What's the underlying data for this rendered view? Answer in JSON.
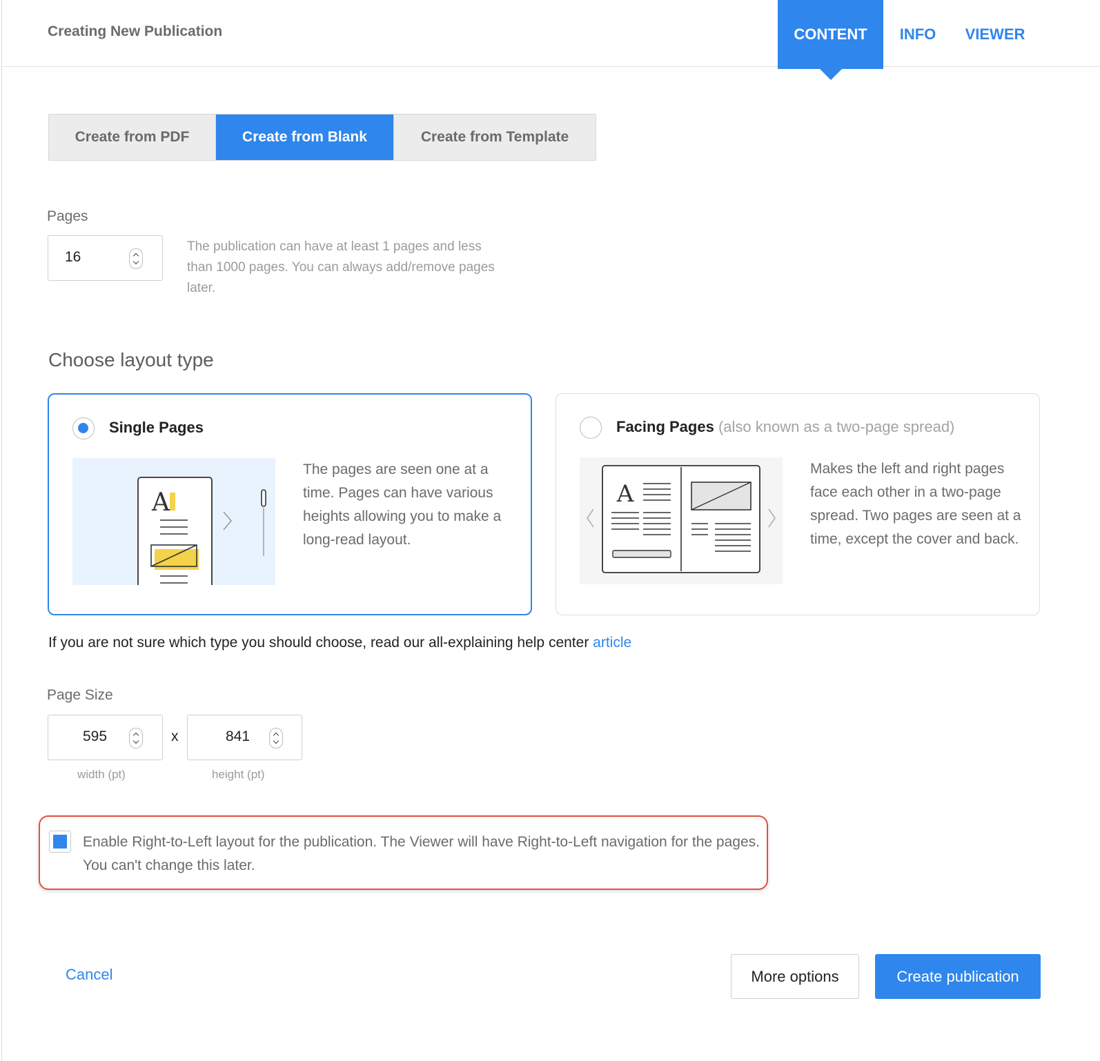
{
  "header": {
    "title": "Creating New Publication",
    "tabs": [
      {
        "label": "CONTENT"
      },
      {
        "label": "INFO"
      },
      {
        "label": "VIEWER"
      }
    ]
  },
  "source_options": {
    "items": [
      {
        "label": "Create from PDF"
      },
      {
        "label": "Create from Blank"
      },
      {
        "label": "Create from Template"
      }
    ],
    "selected": "Create from Blank"
  },
  "pages": {
    "label": "Pages",
    "value": "16",
    "hint": "The publication can have at least 1 pages and less than 1000 pages. You can always add/remove pages later."
  },
  "layout": {
    "title": "Choose layout type",
    "single": {
      "title": "Single Pages",
      "description": "The pages are seen one at a time. Pages can have various heights allowing you to make a long-read layout."
    },
    "facing": {
      "title": "Facing Pages",
      "subtitle": "(also known as a two-page spread)",
      "description": "Makes the left and right pages face each other in a two-page spread. Two pages are seen at a time, except the cover and back."
    },
    "selected": "Single Pages"
  },
  "help": {
    "text": "If you are not sure which type you should choose, read our all-explaining help center",
    "link": "article"
  },
  "page_size": {
    "label": "Page Size",
    "width": "595",
    "height": "841",
    "separator": "x",
    "width_label": "width (pt)",
    "height_label": "height (pt)"
  },
  "rtl": {
    "checked": true,
    "text": "Enable Right-to-Left layout for the publication. The Viewer will have Right-to-Left navigation for the pages. You can't change this later."
  },
  "footer": {
    "cancel": "Cancel",
    "more_options": "More options",
    "create": "Create publication"
  },
  "colors": {
    "accent": "#2f86ec",
    "highlight": "#e0523c"
  }
}
